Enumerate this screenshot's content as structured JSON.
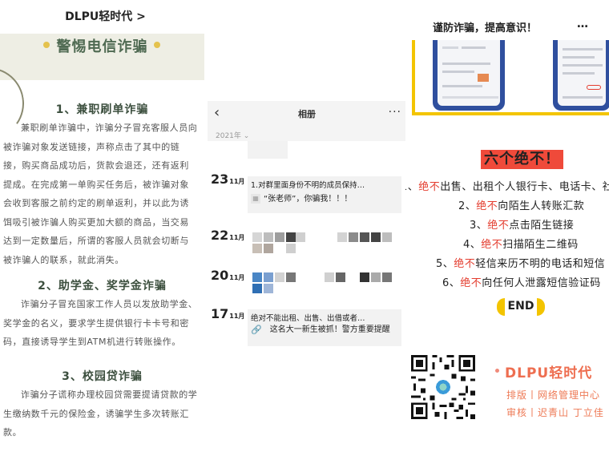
{
  "left": {
    "top_title": "DLPU轻时代 >",
    "banner_title": "警惕电信诈骗",
    "sections": [
      {
        "heading": "1、兼职刷单诈骗",
        "lines": [
          "兼职刷单诈骗中，诈骗分子冒充客服人员向",
          "被诈骗对象发送链接，声称点击了其中的链",
          "接，购买商品成功后，货款会退还，还有返利",
          "提成。在完成第一单购买任务后，被诈骗对象",
          "会收到客服之前约定的刷单返利，并以此为诱",
          "饵吸引被诈骗人购买更加大额的商品，当交易",
          "达到一定数量后，所谓的客服人员就会切断与",
          "被诈骗人的联系，就此消失。"
        ]
      },
      {
        "heading": "2、助学金、奖学金诈骗",
        "lines": [
          "诈骗分子冒充国家工作人员以发放助学金、",
          "奖学金的名义，要求学生提供银行卡卡号和密",
          "码，直接诱导学生到ATM机进行转账操作。"
        ]
      },
      {
        "heading": "3、校园贷诈骗",
        "lines": [
          "诈骗分子谎称办理校园贷需要提请贷款的学",
          "生缴纳数千元的保险金，诱骗学生多次转账汇",
          "款。"
        ]
      }
    ]
  },
  "middle": {
    "back_icon": "‹",
    "title": "相册",
    "more_icon": "···",
    "year": "2021年 ⌄",
    "entries": [
      {
        "day": "23",
        "month": "11月",
        "text": "1.对群里面身份不明的成员保持…",
        "sub": "“张老师”，你骗我！！！"
      },
      {
        "day": "22",
        "month": "11月"
      },
      {
        "day": "20",
        "month": "11月"
      },
      {
        "day": "17",
        "month": "11月",
        "text": "绝对不能出租、出售、出借或者…",
        "sub": "这名大一新生被抓！警方重要提醒"
      }
    ]
  },
  "right": {
    "top_title": "谨防诈骗，提高意识！",
    "top_more": "…",
    "six_title": "六个绝不！",
    "rules": [
      {
        "pre": "1、",
        "red": "绝不",
        "rest": "出售、出租个人银行卡、电话卡、社"
      },
      {
        "pre": "2、",
        "red": "绝不",
        "rest": "向陌生人转账汇款"
      },
      {
        "pre": "3、",
        "red": "绝不",
        "rest": "点击陌生链接"
      },
      {
        "pre": "4、",
        "red": "绝不",
        "rest": "扫描陌生二维码"
      },
      {
        "pre": "5、",
        "red": "绝不",
        "rest": "轻信来历不明的电话和短信"
      },
      {
        "pre": "6、",
        "red": "绝不",
        "rest": "向任何人泄露短信验证码"
      }
    ],
    "end_label": "END",
    "brand": "DLPU轻时代",
    "credits": [
      "排版丨网络管理中心",
      "审核丨迟青山 丁立佳"
    ]
  },
  "colors": {
    "accent_red": "#e43d2f",
    "accent_yellow": "#f3c400",
    "banner_green": "#4f6a52",
    "brand_orange": "#ee6e50"
  }
}
